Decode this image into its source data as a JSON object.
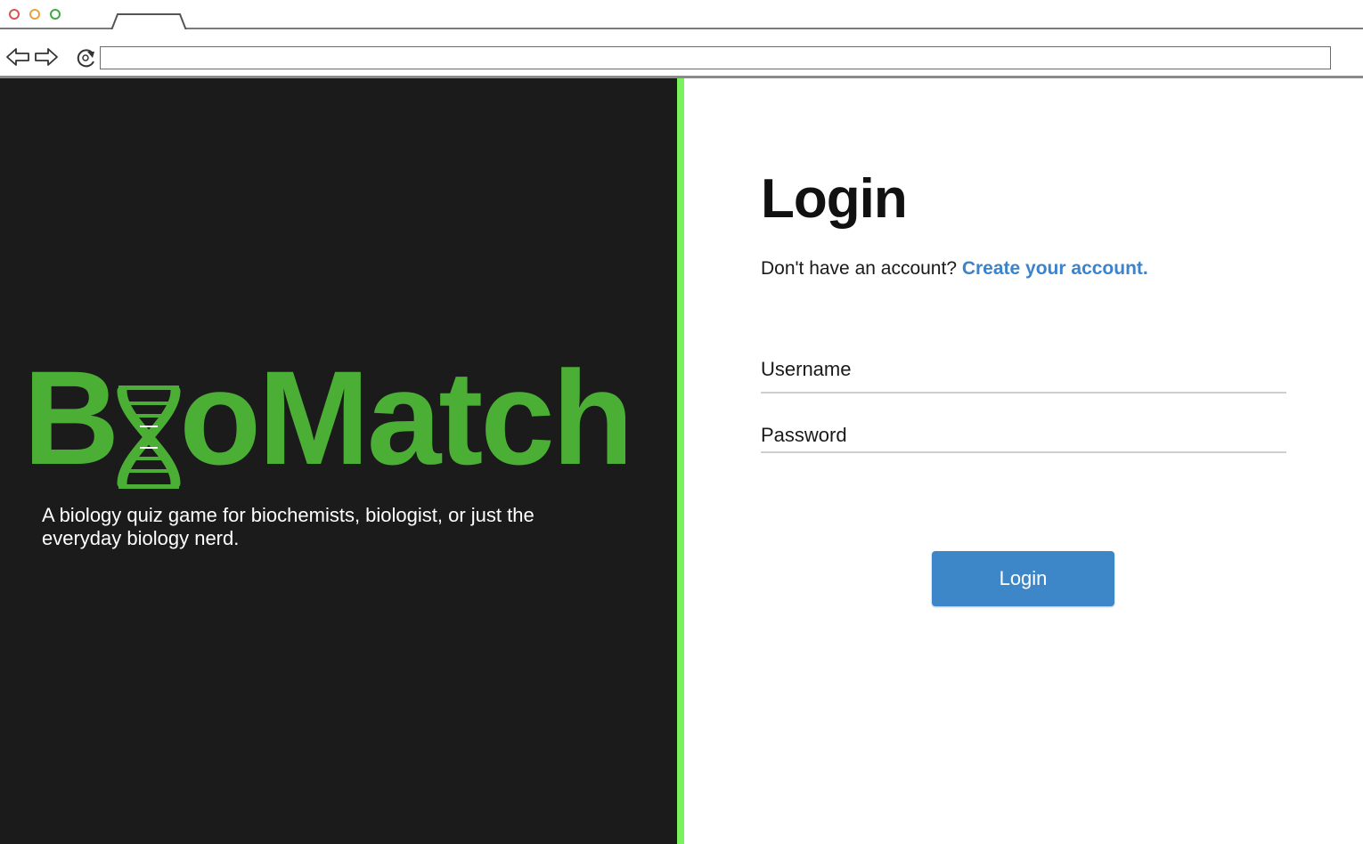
{
  "browser": {
    "address_value": ""
  },
  "branding": {
    "logo_text_prefix": "B",
    "logo_text_suffix": "oMatch",
    "logo_text": "BioMatch",
    "logo_color": "#4caf35",
    "tagline": "A biology quiz game for biochemists, biologist, or just the everyday biology nerd."
  },
  "login": {
    "title": "Login",
    "signup_prompt": "Don't have an account?",
    "signup_link": "Create your account.",
    "username_label": "Username",
    "password_label": "Password",
    "submit_label": "Login"
  },
  "colors": {
    "left_panel_bg": "#1b1b1b",
    "divider": "#79f25e",
    "link": "#3b83cc",
    "button_bg": "#3d87c9"
  },
  "icons": [
    "back-arrow-icon",
    "forward-arrow-icon",
    "reload-icon",
    "dna-helix-icon"
  ]
}
